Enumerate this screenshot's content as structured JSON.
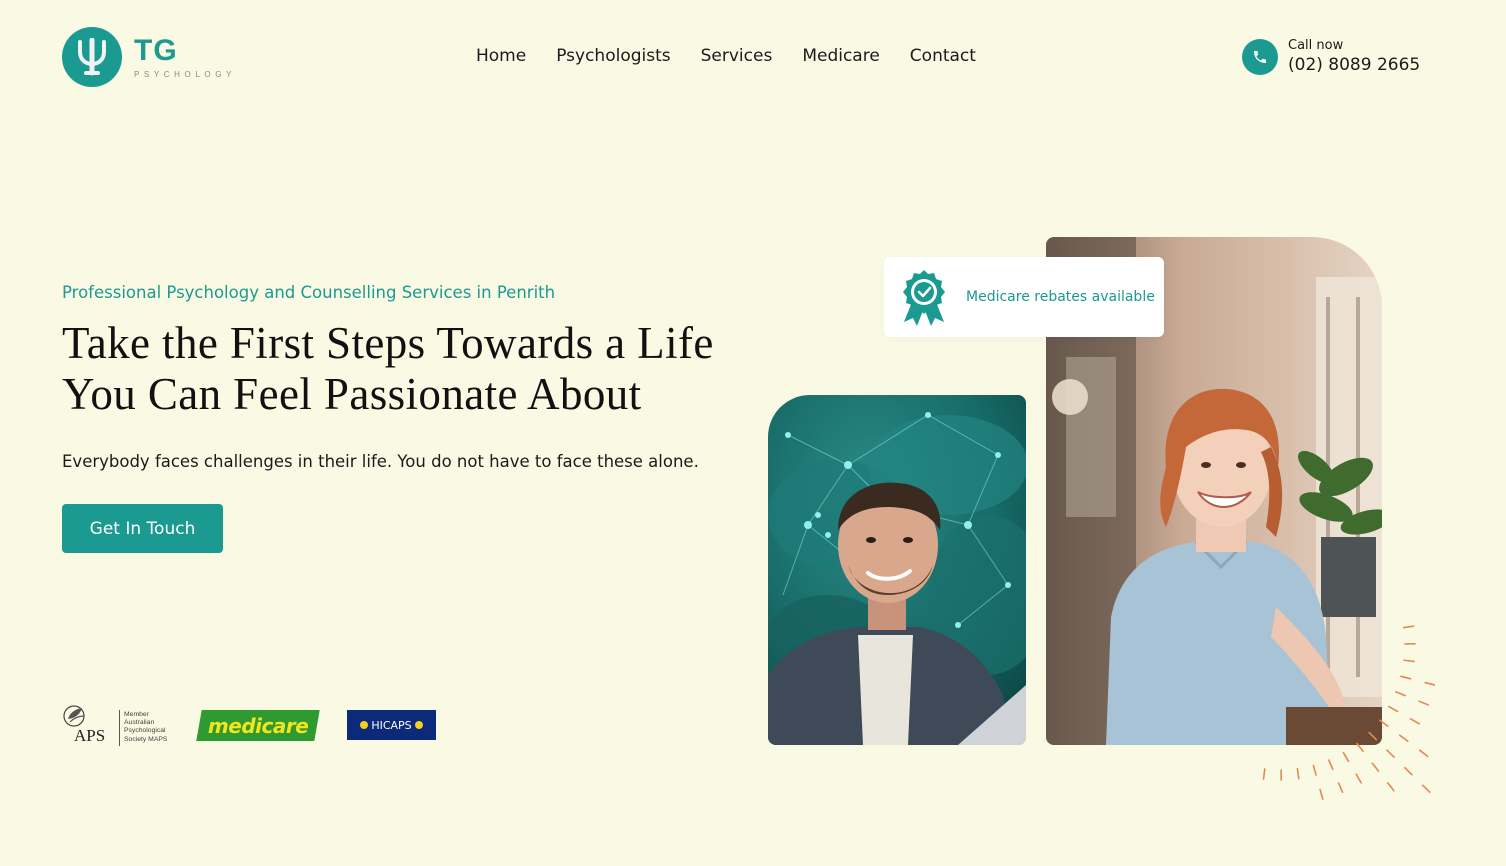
{
  "brand": {
    "name": "TG",
    "tagline": "PSYCHOLOGY",
    "logo_icon": "psi-icon",
    "accent_color": "#1a9a90"
  },
  "nav": {
    "items": [
      {
        "label": "Home"
      },
      {
        "label": "Psychologists"
      },
      {
        "label": "Services"
      },
      {
        "label": "Medicare"
      },
      {
        "label": "Contact"
      }
    ]
  },
  "call": {
    "icon": "phone-icon",
    "label": "Call now",
    "number": "(02) 8089 2665"
  },
  "hero": {
    "eyebrow": "Professional Psychology and Counselling Services in Penrith",
    "headline": "Take the First Steps Towards a Life You Can Feel Passionate About",
    "lede": "Everybody faces challenges in their life. You do not have to face these alone.",
    "cta_label": "Get In Touch"
  },
  "badge": {
    "icon": "award-ribbon-icon",
    "label": "Medicare rebates available"
  },
  "accreditations": {
    "aps": {
      "letters": "APS",
      "member_text": "Member\nAustralian\nPsychological\nSociety MAPS"
    },
    "medicare": "medicare",
    "hicaps": "HICAPS"
  },
  "colors": {
    "background": "#f9f9e4",
    "accent": "#1a9a90",
    "dash_accent": "#e28a53",
    "medicare_green": "#2f9a2f",
    "medicare_yellow": "#f3e51b",
    "hicaps_navy": "#0d2a7a"
  }
}
